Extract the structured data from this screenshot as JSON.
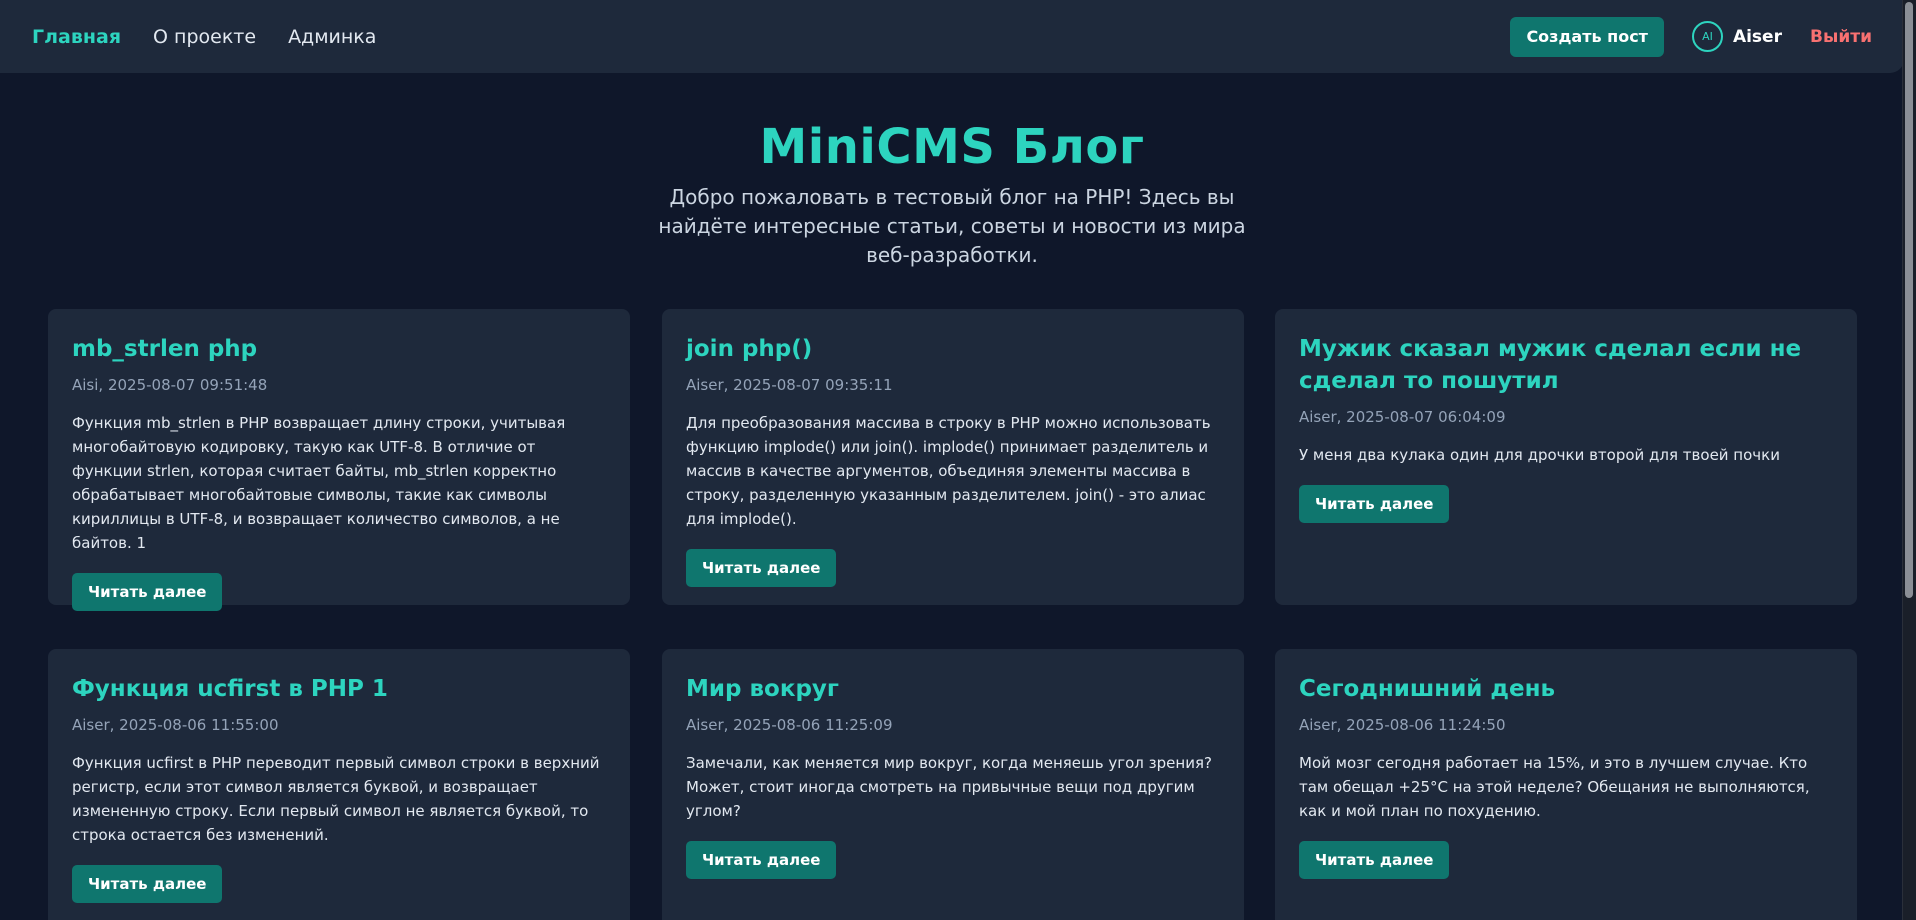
{
  "nav": {
    "links": [
      "Главная",
      "О проекте",
      "Админка"
    ],
    "create_label": "Создать пост",
    "avatar_initials": "AI",
    "username": "Aiser",
    "logout_label": "Выйти"
  },
  "hero": {
    "title": "MiniCMS Блог",
    "subtitle": "Добро пожаловать в тестовый блог на PHP! Здесь вы найдёте интересные статьи, советы и новости из мира веб-разработки."
  },
  "posts": [
    {
      "title": "mb_strlen php",
      "meta": "Aisi, 2025-08-07 09:51:48",
      "excerpt": "Функция mb_strlen в PHP возвращает длину строки, учитывая многобайтовую кодировку, такую как UTF-8. В отличие от функции strlen, которая считает байты, mb_strlen корректно обрабатывает многобайтовые символы, такие как символы кириллицы в UTF-8, и возвращает количество символов, а не байтов. 1",
      "read_label": "Читать далее"
    },
    {
      "title": "join php()",
      "meta": "Aiser, 2025-08-07 09:35:11",
      "excerpt": "Для преобразования массива в строку в PHP можно использовать функцию implode() или join(). implode() принимает разделитель и массив в качестве аргументов, объединяя элементы массива в строку, разделенную указанным разделителем. join() - это алиас для implode().",
      "read_label": "Читать далее"
    },
    {
      "title": "Мужик сказал мужик сделал если не сделал то пошутил",
      "meta": "Aiser, 2025-08-07 06:04:09",
      "excerpt": "У меня два кулака один для дрочки второй для твоей почки",
      "read_label": "Читать далее"
    },
    {
      "title": "Функция ucfirst в PHP 1",
      "meta": "Aiser, 2025-08-06 11:55:00",
      "excerpt": "Функция ucfirst в PHP переводит первый символ строки в верхний регистр, если этот символ является буквой, и возвращает измененную строку. Если первый символ не является буквой, то строка остается без изменений.",
      "read_label": "Читать далее"
    },
    {
      "title": "Мир вокруг",
      "meta": "Aiser, 2025-08-06 11:25:09",
      "excerpt": "Замечали, как меняется мир вокруг, когда меняешь угол зрения? Может, стоит иногда смотреть на привычные вещи под другим углом?",
      "read_label": "Читать далее"
    },
    {
      "title": "Сегоднишний день",
      "meta": "Aiser, 2025-08-06 11:24:50",
      "excerpt": "Мой мозг сегодня работает на 15%, и это в лучшем случае. Кто там обещал +25°C на этой неделе? Обещания не выполняются, как и мой план по похудению.",
      "read_label": "Читать далее"
    }
  ]
}
